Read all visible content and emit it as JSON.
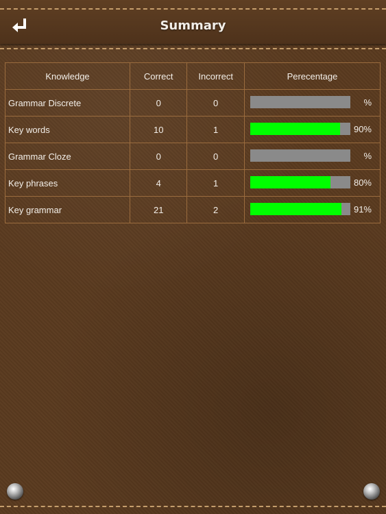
{
  "header": {
    "title": "Summary",
    "back_icon": "return-arrow-icon"
  },
  "table": {
    "columns": [
      "Knowledge",
      "Correct",
      "Incorrect",
      "Perecentage"
    ],
    "rows": [
      {
        "knowledge": "Grammar Discrete",
        "correct": "0",
        "incorrect": "0",
        "percent_text": "%",
        "fill": 0
      },
      {
        "knowledge": "Key words",
        "correct": "10",
        "incorrect": "1",
        "percent_text": "90%",
        "fill": 0.9
      },
      {
        "knowledge": "Grammar Cloze",
        "correct": "0",
        "incorrect": "0",
        "percent_text": "%",
        "fill": 0
      },
      {
        "knowledge": "Key phrases",
        "correct": "4",
        "incorrect": "1",
        "percent_text": "80%",
        "fill": 0.8
      },
      {
        "knowledge": "Key grammar",
        "correct": "21",
        "incorrect": "2",
        "percent_text": "91%",
        "fill": 0.91
      }
    ]
  },
  "colors": {
    "progress_fill": "#00ff00",
    "progress_track": "#8a8a8a",
    "leather": "#5a3a1f"
  }
}
